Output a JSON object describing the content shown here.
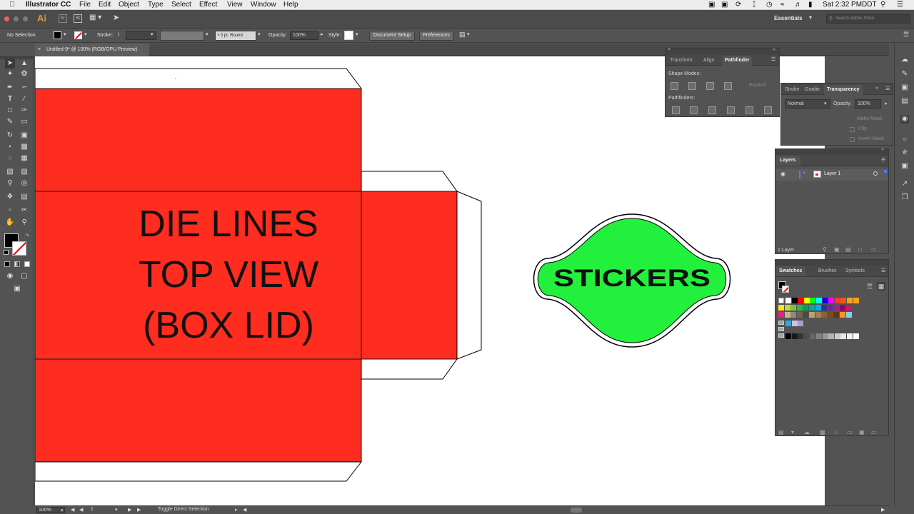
{
  "menubar": {
    "app_name": "Illustrator CC",
    "menus": [
      "File",
      "Edit",
      "Object",
      "Type",
      "Select",
      "Effect",
      "View",
      "Window",
      "Help"
    ],
    "clock": "Sat 2:32 PM",
    "user": "DDT"
  },
  "appbar": {
    "logo": "Ai",
    "bridge": "Br",
    "st": "St",
    "workspace": "Essentials",
    "search_placeholder": "Search Adobe Stock"
  },
  "control": {
    "selection": "No Selection",
    "stroke_label": "Stroke:",
    "brush": "3 pt. Round",
    "opacity_label": "Opacity:",
    "opacity_value": "100%",
    "style_label": "Style:",
    "doc_setup": "Document Setup",
    "preferences": "Preferences"
  },
  "document": {
    "tab_title": "Untitled-9* @ 100% (RGB/GPU Preview)"
  },
  "artwork": {
    "main_text": [
      "DIE LINES",
      "TOP VIEW",
      "(BOX LID)"
    ],
    "sticker_text": "STICKERS",
    "colors": {
      "red": "#ff2c1f",
      "green": "#22f03c",
      "outline": "#000000"
    }
  },
  "pathfinder": {
    "tabs": [
      "Transform",
      "Align",
      "Pathfinder"
    ],
    "shape_modes": "Shape Modes:",
    "expand": "Expand",
    "pathfinders": "Pathfinders:"
  },
  "transparency": {
    "tabs": [
      "Stroke",
      "Gradie",
      "Transparency"
    ],
    "blend_mode": "Normal",
    "opacity_label": "Opacity:",
    "opacity_value": "100%",
    "make_mask": "Make Mask",
    "clip": "Clip",
    "invert_mask": "Invert Mask"
  },
  "layers": {
    "tab": "Layers",
    "layer_name": "Layer 1",
    "count": "1 Layer"
  },
  "swatches": {
    "tabs": [
      "Swatches",
      "Brushes",
      "Symbols"
    ],
    "row1": [
      "#ffffff",
      "#000000",
      "#ff0000",
      "#ffff00",
      "#00ff00",
      "#00ffff",
      "#0000ff",
      "#ff00ff",
      "#ff3a2a",
      "#e85a1a",
      "#f7a21b",
      "#f7a21b"
    ],
    "row2": [
      "#fbe21a",
      "#c8d62e",
      "#7ac143",
      "#37b34a",
      "#00a651",
      "#00a99d",
      "#00aeef",
      "#2e3192",
      "#662d91",
      "#92278f",
      "#9e005d",
      "#d4145a"
    ],
    "row3": [
      "#ed1e79",
      "#c7b299",
      "#998675",
      "#736357",
      "#534741",
      "#c69c6d",
      "#a67c52",
      "#8c6239",
      "#754c24",
      "#603813",
      "#f7931e",
      "#7fd1e8"
    ],
    "row4": [
      "#29abe2",
      "#d0c0e8",
      "#a9a0d0"
    ],
    "grays": [
      "#000000",
      "#1a1a1a",
      "#333333",
      "#4d4d4d",
      "#666666",
      "#808080",
      "#999999",
      "#b3b3b3",
      "#cccccc",
      "#e6e6e6",
      "#f2f2f2",
      "#ffffff"
    ]
  },
  "status": {
    "zoom": "100%",
    "artboard": "1",
    "tool_hint": "Toggle Direct Selection"
  }
}
